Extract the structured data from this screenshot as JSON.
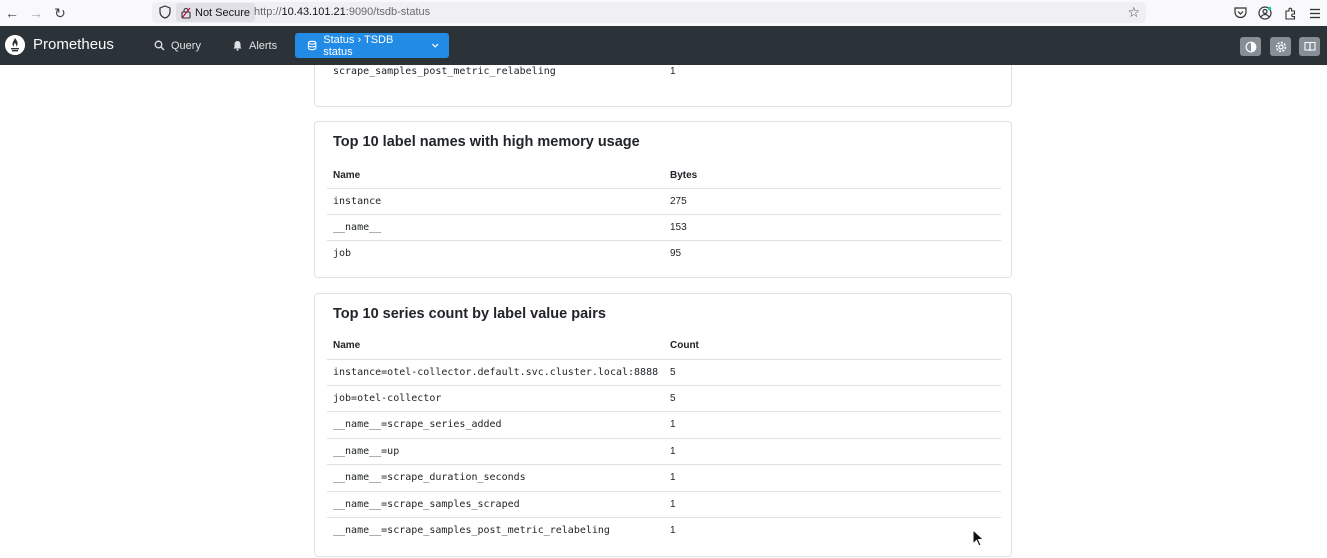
{
  "browser": {
    "security_label": "Not Secure",
    "url_prefix": "http://",
    "url_host": "10.43.101.21",
    "url_rest": ":9090/tsdb-status"
  },
  "navbar": {
    "brand": "Prometheus",
    "query_label": "Query",
    "alerts_label": "Alerts",
    "status_label": "Status › TSDB status"
  },
  "prev_section": {
    "rows": [
      {
        "name": "scrape_samples_post_metric_relabeling",
        "value": "1"
      }
    ]
  },
  "label_memory": {
    "title": "Top 10 label names with high memory usage",
    "col_name": "Name",
    "col_value": "Bytes",
    "rows": [
      {
        "name": "instance",
        "value": "275"
      },
      {
        "name": "__name__",
        "value": "153"
      },
      {
        "name": "job",
        "value": "95"
      }
    ]
  },
  "series_pairs": {
    "title": "Top 10 series count by label value pairs",
    "col_name": "Name",
    "col_value": "Count",
    "rows": [
      {
        "name": "instance=otel-collector.default.svc.cluster.local:8888",
        "value": "5"
      },
      {
        "name": "job=otel-collector",
        "value": "5"
      },
      {
        "name": "__name__=scrape_series_added",
        "value": "1"
      },
      {
        "name": "__name__=up",
        "value": "1"
      },
      {
        "name": "__name__=scrape_duration_seconds",
        "value": "1"
      },
      {
        "name": "__name__=scrape_samples_scraped",
        "value": "1"
      },
      {
        "name": "__name__=scrape_samples_post_metric_relabeling",
        "value": "1"
      }
    ]
  }
}
